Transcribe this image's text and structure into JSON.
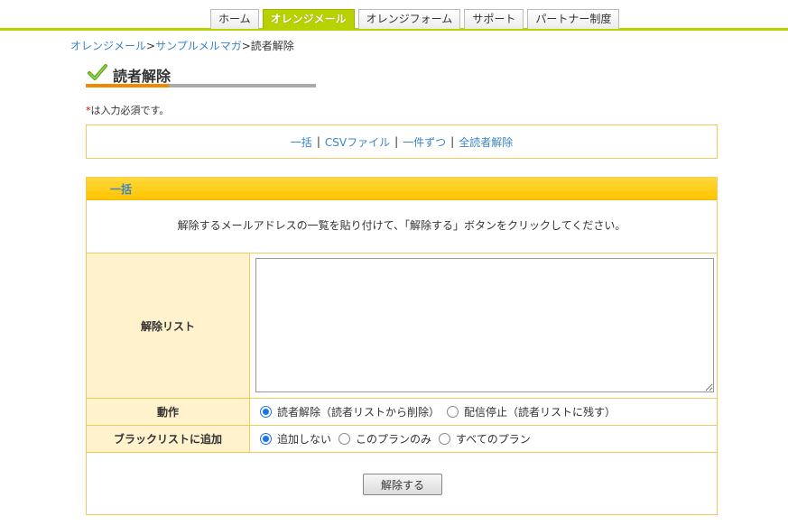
{
  "nav": {
    "tabs": [
      {
        "label": "ホーム",
        "active": false
      },
      {
        "label": "オレンジメール",
        "active": true
      },
      {
        "label": "オレンジフォーム",
        "active": false
      },
      {
        "label": "サポート",
        "active": false
      },
      {
        "label": "パートナー制度",
        "active": false
      }
    ],
    "accent_color": "#b8d200"
  },
  "breadcrumb": {
    "items": [
      "オレンジメール",
      "サンプルメルマガ"
    ],
    "current": "読者解除",
    "separator": ">"
  },
  "page": {
    "title": "読者解除",
    "title_icon": "check-icon",
    "required_star": "*",
    "required_note": "は入力必須です。"
  },
  "modes": {
    "links": [
      "一括",
      "CSVファイル",
      "一件ずつ",
      "全読者解除"
    ],
    "separator": "|"
  },
  "panel": {
    "heading": "一括",
    "description": "解除するメールアドレスの一覧を貼り付けて、「解除する」ボタンをクリックしてください。",
    "list_label": "解除リスト",
    "list_value": "",
    "action_label": "動作",
    "action_options": [
      {
        "label": "読者解除（読者リストから削除）",
        "selected": true
      },
      {
        "label": "配信停止（読者リストに残す）",
        "selected": false
      }
    ],
    "blacklist_label": "ブラックリストに追加",
    "blacklist_options": [
      {
        "label": "追加しない",
        "selected": true
      },
      {
        "label": "このプランのみ",
        "selected": false
      },
      {
        "label": "すべてのプラン",
        "selected": false
      }
    ],
    "submit_label": "解除する",
    "header_color": "#ffc400",
    "border_color": "#f5c85a"
  }
}
